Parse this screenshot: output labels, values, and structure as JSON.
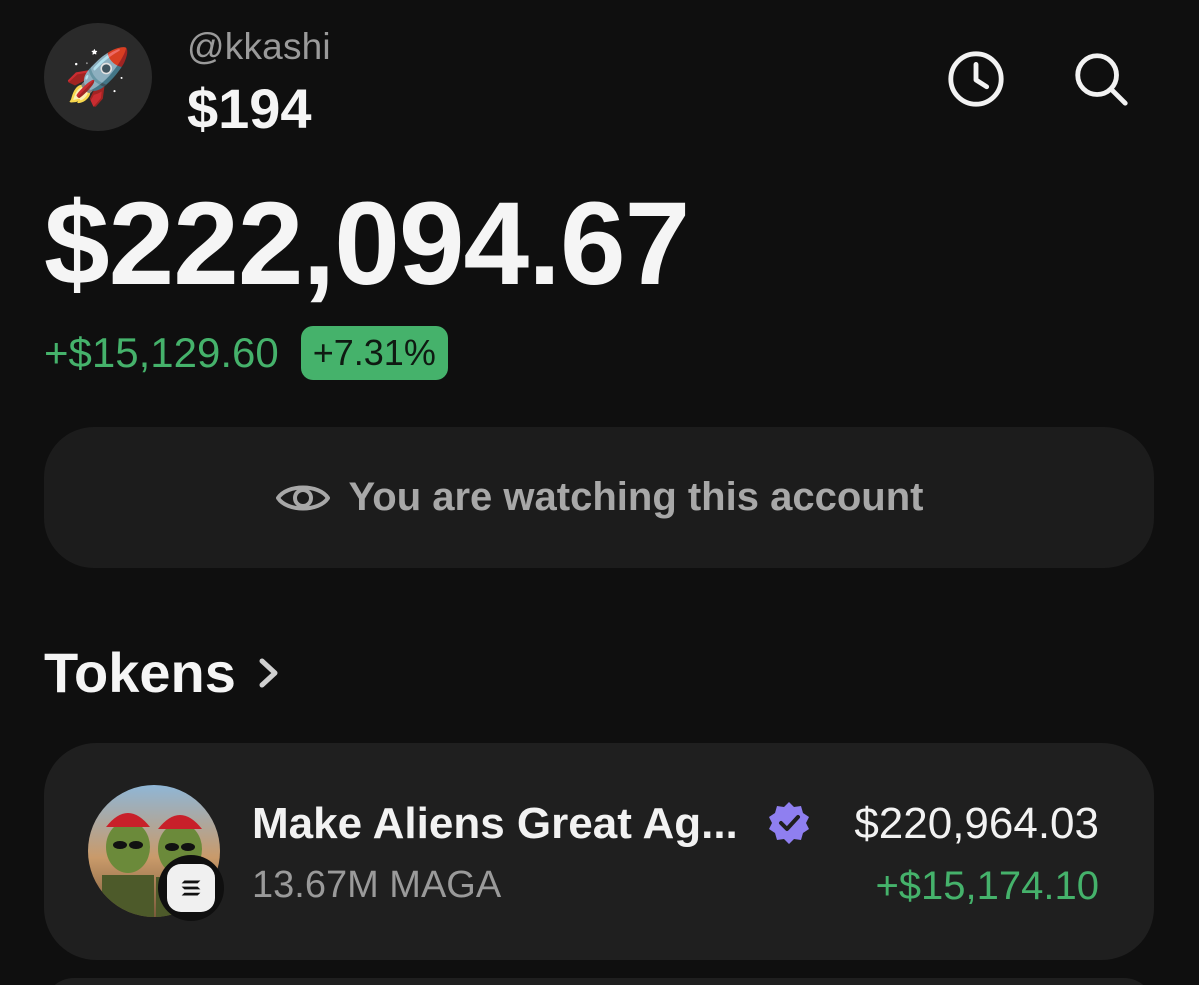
{
  "profile": {
    "avatar_emoji": "🚀",
    "username": "@kkashi",
    "balance": "$194"
  },
  "header_icons": {
    "history": "clock-icon",
    "search": "search-icon"
  },
  "portfolio": {
    "total": "$222,094.67",
    "change_amount": "+$15,129.60",
    "change_percent": "+7.31%"
  },
  "watching_banner": {
    "icon": "eye-icon",
    "text": "You are watching this account"
  },
  "tokens": {
    "title": "Tokens",
    "items": [
      {
        "name": "Make Aliens Great Ag...",
        "verified": true,
        "amount": "13.67M MAGA",
        "value": "$220,964.03",
        "change": "+$15,174.10"
      }
    ]
  },
  "colors": {
    "background": "#0f0f0f",
    "card": "#1f1f1f",
    "positive": "#45b26b",
    "verified": "#8f7ff0"
  }
}
